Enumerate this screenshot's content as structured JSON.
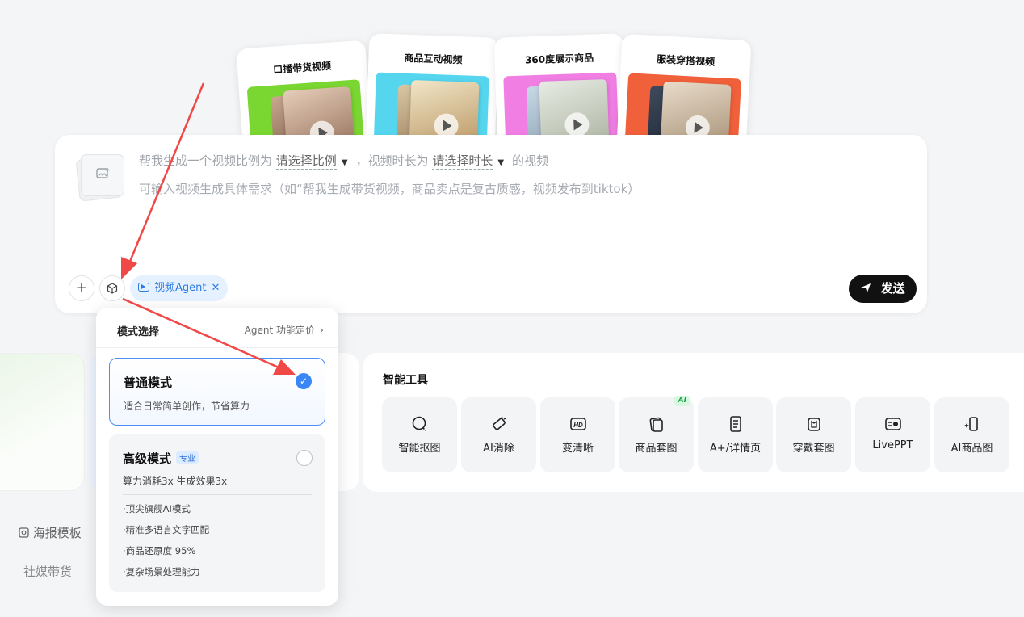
{
  "template_cards": [
    {
      "title": "口播带货视频",
      "color": "#7ad631"
    },
    {
      "title": "商品互动视频",
      "color": "#56d6ee"
    },
    {
      "title": "360度展示商品",
      "color": "#f07ee3"
    },
    {
      "title": "服装穿搭视频",
      "color": "#f0603a"
    }
  ],
  "composer": {
    "prefix": "帮我生成一个视频比例为",
    "ratio_select": "请选择比例",
    "middle": "，视频时长为",
    "duration_select": "请选择时长",
    "suffix": "的视频",
    "placeholder": "可输入视频生成具体需求（如“帮我生成带货视频，商品卖点是复古质感，视频发布到tiktok）",
    "plus_icon": "plus-icon",
    "mode_icon": "cube-icon",
    "agent_chip": "视频Agent",
    "send_label": "发送"
  },
  "popup": {
    "title": "模式选择",
    "link": "Agent 功能定价",
    "normal": {
      "name": "普通模式",
      "desc": "适合日常简单创作，节省算力",
      "selected": true
    },
    "advanced": {
      "name": "高级模式",
      "badge": "专业",
      "sub": "算力消耗3x 生成效果3x",
      "features": [
        "·顶尖旗舰AI模式",
        "·精准多语言文字匹配",
        "·商品还原度 95%",
        "·复杂场景处理能力"
      ],
      "selected": false
    }
  },
  "tools": {
    "title": "智能工具",
    "items": [
      {
        "label": "智能抠图",
        "icon": "lasso-icon"
      },
      {
        "label": "AI消除",
        "icon": "eraser-icon"
      },
      {
        "label": "变清晰",
        "icon": "hd-icon"
      },
      {
        "label": "商品套图",
        "icon": "product-set-icon",
        "badge": "AI"
      },
      {
        "label": "A+/详情页",
        "icon": "detail-page-icon"
      },
      {
        "label": "穿戴套图",
        "icon": "apparel-icon"
      },
      {
        "label": "LivePPT",
        "icon": "ppt-icon"
      },
      {
        "label": "AI商品图",
        "icon": "ai-product-icon"
      }
    ]
  },
  "left_nav": {
    "item1": "海报模板",
    "item2": "社媒带货"
  },
  "accent": "#3a86f5"
}
